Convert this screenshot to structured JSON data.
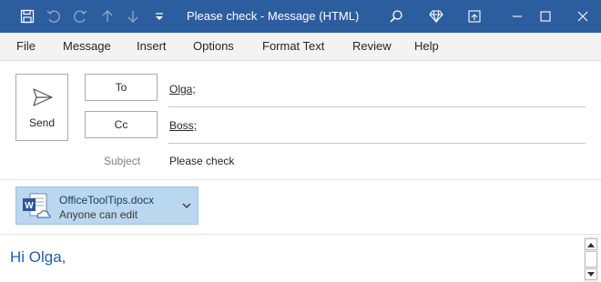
{
  "window": {
    "title": "Please check  -  Message (HTML)"
  },
  "colors": {
    "titlebar": "#2c5d9e",
    "accent": "#1f5fa8",
    "attachment_bg": "#b9d7ee"
  },
  "quick_access_icons": [
    "save-icon",
    "undo-icon",
    "redo-icon",
    "up-arrow-icon",
    "down-arrow-icon",
    "customize-icon"
  ],
  "title_icons": [
    "search-icon",
    "diamond-icon",
    "restore-ribbon-icon",
    "minimize-icon",
    "maximize-icon",
    "close-icon"
  ],
  "menu": {
    "items": [
      "File",
      "Message",
      "Insert",
      "Options",
      "Format Text",
      "Review",
      "Help"
    ]
  },
  "compose": {
    "send_label": "Send",
    "to_label": "To",
    "to_value": "Olga;",
    "cc_label": "Cc",
    "cc_value": "Boss;",
    "subject_label": "Subject",
    "subject_value": "Please check"
  },
  "attachment": {
    "file_name": "OfficeToolTips.docx",
    "permission": "Anyone can edit",
    "icon": "word-document-icon"
  },
  "body": {
    "text": "Hi Olga,"
  }
}
